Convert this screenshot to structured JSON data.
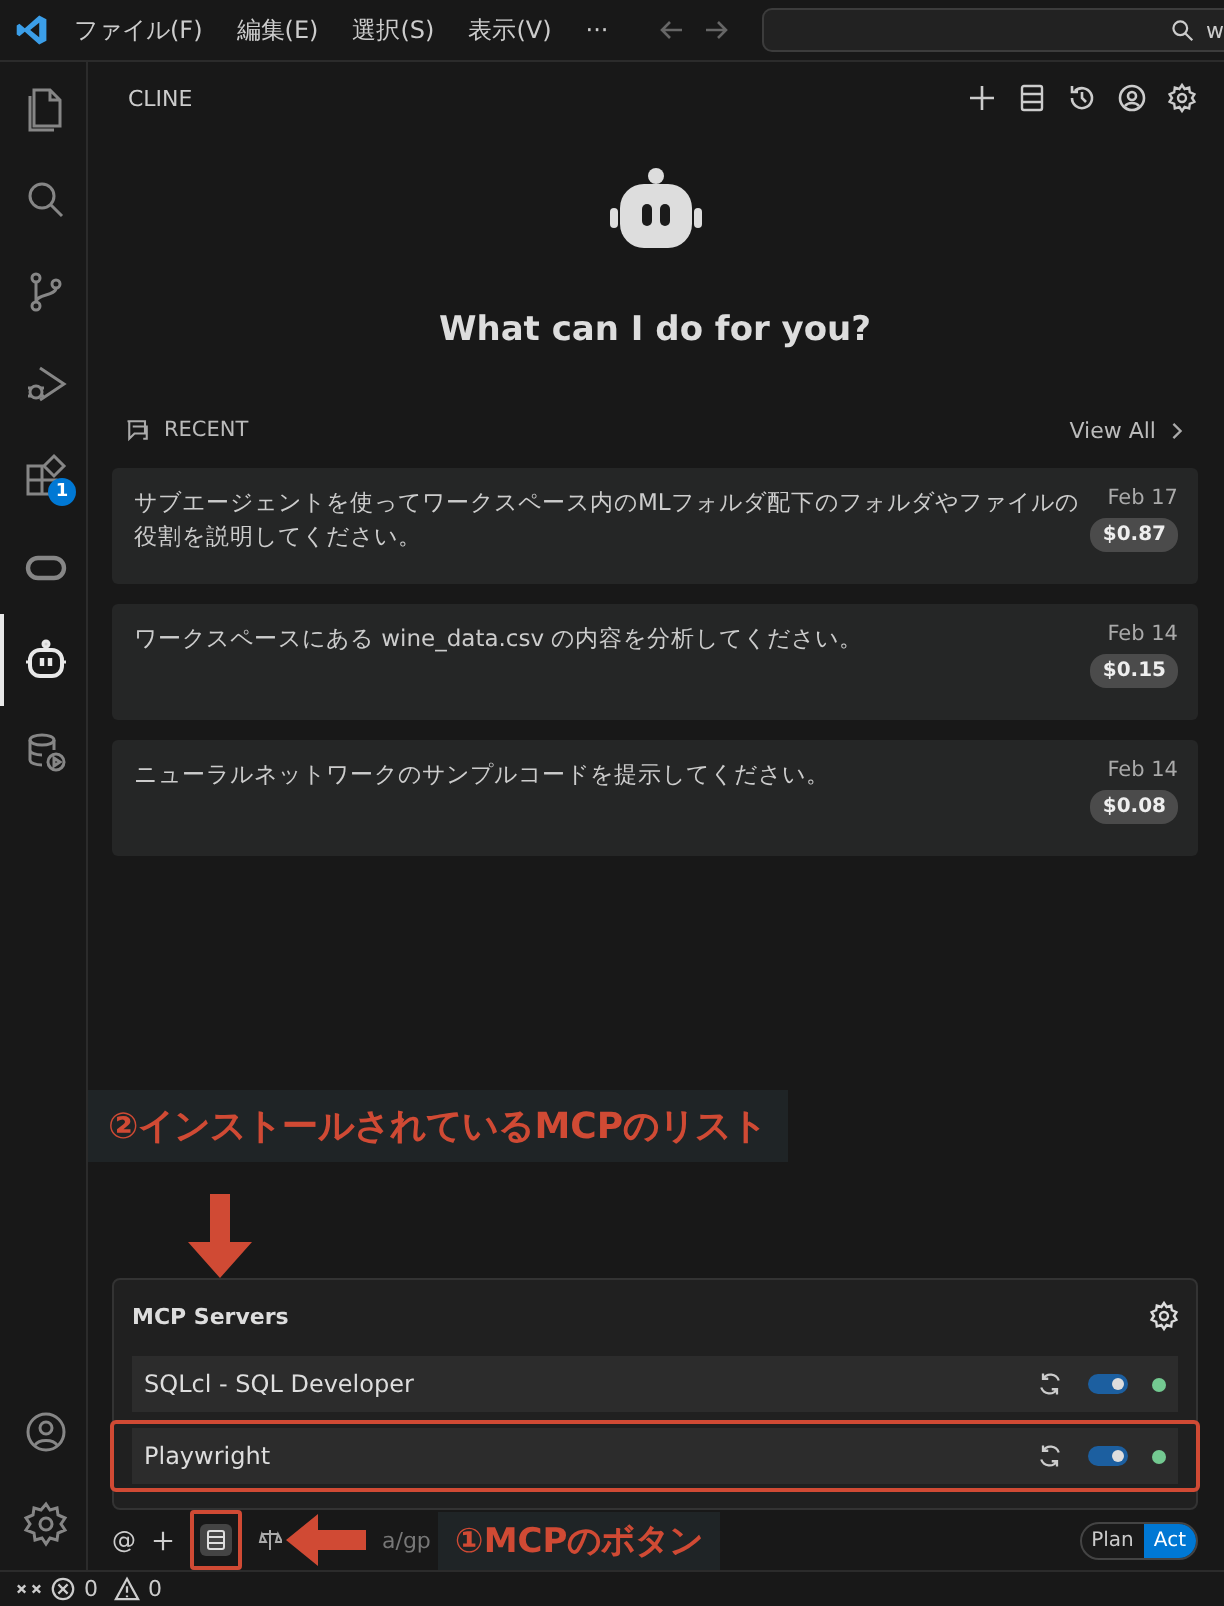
{
  "title_bar": {
    "menus": [
      "ファイル(F)",
      "編集(E)",
      "選択(S)",
      "表示(V)",
      "···"
    ],
    "search": {
      "value": "w"
    }
  },
  "activity_bar": {
    "items": [
      {
        "kind": "files",
        "selected": false
      },
      {
        "kind": "search",
        "selected": false
      },
      {
        "kind": "source-control",
        "selected": false
      },
      {
        "kind": "run-debug",
        "selected": false
      },
      {
        "kind": "extensions",
        "selected": false,
        "badge": "1"
      },
      {
        "kind": "oracle",
        "selected": false
      },
      {
        "kind": "robot",
        "selected": true
      },
      {
        "kind": "database",
        "selected": false
      }
    ],
    "bottom": [
      {
        "kind": "account"
      },
      {
        "kind": "settings"
      }
    ]
  },
  "panel": {
    "title": "CLINE"
  },
  "welcome": {
    "heading": "What can I do for you?"
  },
  "recent": {
    "label": "RECENT",
    "view_all": "View All",
    "tasks": [
      {
        "text": "サブエージェントを使ってワークスペース内のMLフォルダ配下のフォルダやファイルの役割を説明してください。",
        "date": "Feb 17",
        "cost": "$0.87"
      },
      {
        "text": "ワークスペースにある wine_data.csv の内容を分析してください。",
        "date": "Feb 14",
        "cost": "$0.15"
      },
      {
        "text": "ニューラルネットワークのサンプルコードを提示してください。",
        "date": "Feb 14",
        "cost": "$0.08"
      }
    ]
  },
  "mcp": {
    "title": "MCP Servers",
    "servers": [
      {
        "name": "SQLcl - SQL Developer",
        "enabled": true,
        "color": "#73c991",
        "highlighted": false
      },
      {
        "name": "Playwright",
        "enabled": true,
        "color": "#73c991",
        "highlighted": true
      }
    ]
  },
  "input_bar": {
    "mention": "@",
    "model": "a/gp",
    "modes": [
      {
        "label": "Plan",
        "selected": false
      },
      {
        "label": "Act",
        "selected": true
      }
    ]
  },
  "annotations": {
    "list_label": "②インストールされているMCPのリスト",
    "button_label": "①MCPのボタン"
  },
  "status_bar": {
    "errors": "0",
    "warnings": "0"
  }
}
